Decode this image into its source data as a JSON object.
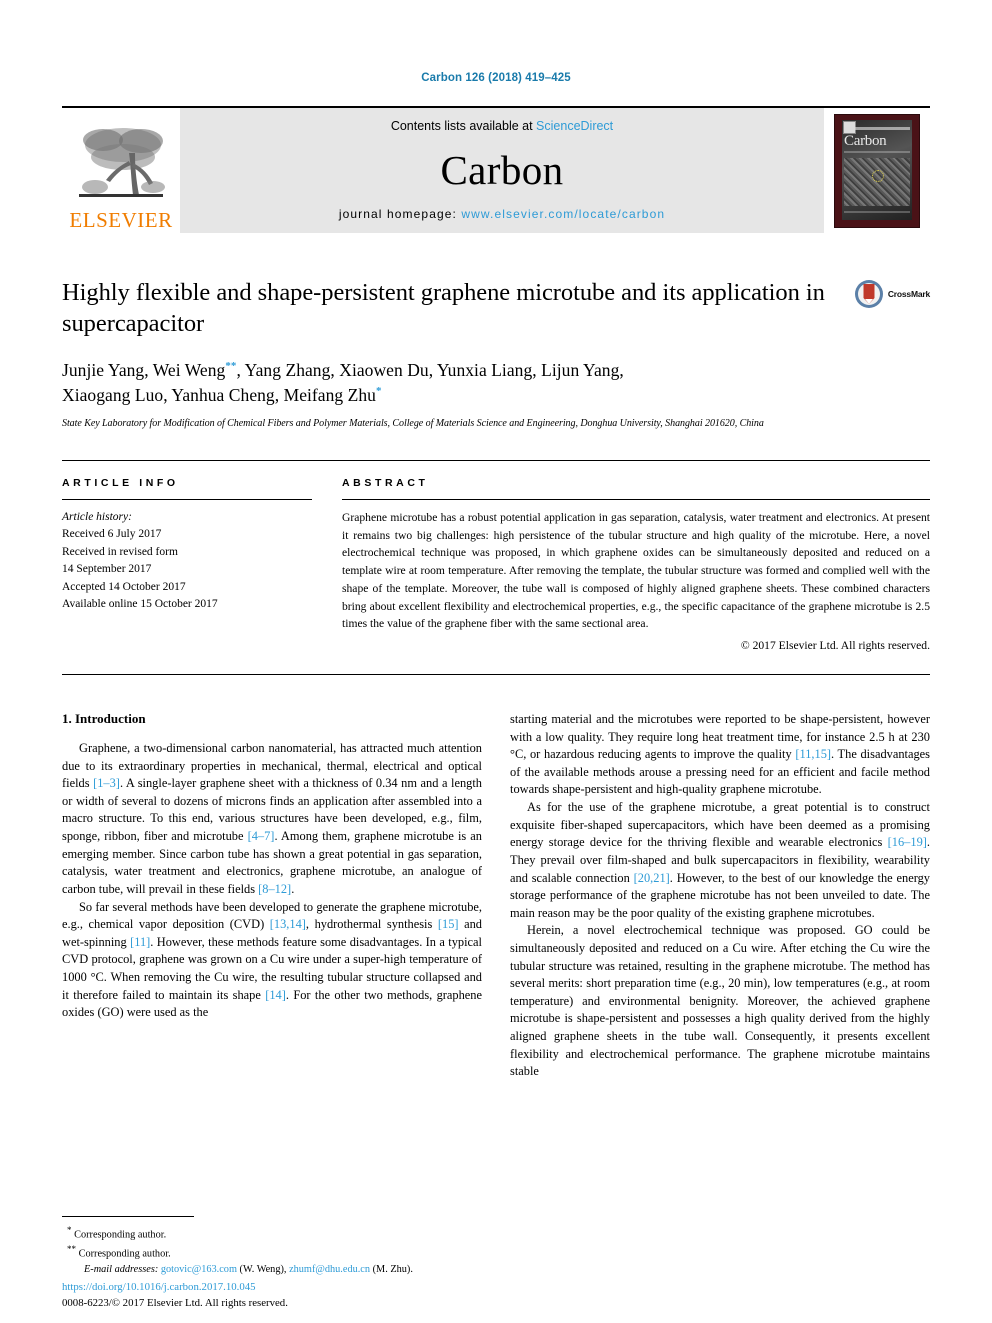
{
  "running_head": "Carbon 126 (2018) 419–425",
  "masthead": {
    "publisher_logo_text": "ELSEVIER",
    "contents_prefix": "Contents lists available at ",
    "contents_link": "ScienceDirect",
    "journal_name": "Carbon",
    "homepage_prefix": "journal homepage: ",
    "homepage_url": "www.elsevier.com/locate/carbon",
    "cover_title": "Carbon",
    "link_color": "#2e9bd6",
    "elsevier_orange": "#f07d00"
  },
  "article": {
    "title": "Highly flexible and shape-persistent graphene microtube and its application in supercapacitor",
    "crossmark_label": "CrossMark",
    "authors_line1_a": "Junjie Yang, Wei Weng",
    "authors_line1_sup": "**",
    "authors_line1_b": ", Yang Zhang, Xiaowen Du, Yunxia Liang, Lijun Yang,",
    "authors_line2_a": "Xiaogang Luo, Yanhua Cheng, Meifang Zhu",
    "authors_line2_sup": "*",
    "affiliation": "State Key Laboratory for Modification of Chemical Fibers and Polymer Materials, College of Materials Science and Engineering, Donghua University, Shanghai 201620, China"
  },
  "article_info": {
    "heading": "ARTICLE INFO",
    "history_label": "Article history:",
    "history": [
      "Received 6 July 2017",
      "Received in revised form",
      "14 September 2017",
      "Accepted 14 October 2017",
      "Available online 15 October 2017"
    ]
  },
  "abstract": {
    "heading": "ABSTRACT",
    "text": "Graphene microtube has a robust potential application in gas separation, catalysis, water treatment and electronics. At present it remains two big challenges: high persistence of the tubular structure and high quality of the microtube. Here, a novel electrochemical technique was proposed, in which graphene oxides can be simultaneously deposited and reduced on a template wire at room temperature. After removing the template, the tubular structure was formed and complied well with the shape of the template. Moreover, the tube wall is composed of highly aligned graphene sheets. These combined characters bring about excellent flexibility and electrochemical properties, e.g., the specific capacitance of the graphene microtube is 2.5 times the value of the graphene fiber with the same sectional area.",
    "copyright": "© 2017 Elsevier Ltd. All rights reserved."
  },
  "introduction": {
    "heading": "1. Introduction",
    "left_paragraphs": [
      {
        "segments": [
          {
            "t": "Graphene, a two-dimensional carbon nanomaterial, has attracted much attention due to its extraordinary properties in mechanical, thermal, electrical and optical fields ",
            "k": "text"
          },
          {
            "t": "[1–3]",
            "k": "ref"
          },
          {
            "t": ". A single-layer graphene sheet with a thickness of 0.34 nm and a length or width of several to dozens of microns finds an application after assembled into a macro structure. To this end, various structures have been developed, e.g., film, sponge, ribbon, fiber and microtube ",
            "k": "text"
          },
          {
            "t": "[4–7]",
            "k": "ref"
          },
          {
            "t": ". Among them, graphene microtube is an emerging member. Since carbon tube has shown a great potential in gas separation, catalysis, water treatment and electronics, graphene microtube, an analogue of carbon tube, will prevail in these fields ",
            "k": "text"
          },
          {
            "t": "[8–12]",
            "k": "ref"
          },
          {
            "t": ".",
            "k": "text"
          }
        ]
      },
      {
        "segments": [
          {
            "t": "So far several methods have been developed to generate the graphene microtube, e.g., chemical vapor deposition (CVD) ",
            "k": "text"
          },
          {
            "t": "[13,14]",
            "k": "ref"
          },
          {
            "t": ", hydrothermal synthesis ",
            "k": "text"
          },
          {
            "t": "[15]",
            "k": "ref"
          },
          {
            "t": " and wet-spinning ",
            "k": "text"
          },
          {
            "t": "[11]",
            "k": "ref"
          },
          {
            "t": ". However, these methods feature some disadvantages. In a typical CVD protocol, graphene was grown on a Cu wire under a super-high temperature of 1000 °C. When removing the Cu wire, the resulting tubular structure collapsed and it therefore failed to maintain its shape ",
            "k": "text"
          },
          {
            "t": "[14]",
            "k": "ref"
          },
          {
            "t": ". For the other two methods, graphene oxides (GO) were used as the",
            "k": "text"
          }
        ]
      }
    ],
    "right_paragraphs": [
      {
        "continued": true,
        "segments": [
          {
            "t": "starting material and the microtubes were reported to be shape-persistent, however with a low quality. They require long heat treatment time, for instance 2.5 h at 230 °C, or hazardous reducing agents to improve the quality ",
            "k": "text"
          },
          {
            "t": "[11,15]",
            "k": "ref"
          },
          {
            "t": ". The disadvantages of the available methods arouse a pressing need for an efficient and facile method towards shape-persistent and high-quality graphene microtube.",
            "k": "text"
          }
        ]
      },
      {
        "continued": false,
        "segments": [
          {
            "t": "As for the use of the graphene microtube, a great potential is to construct exquisite fiber-shaped supercapacitors, which have been deemed as a promising energy storage device for the thriving flexible and wearable electronics ",
            "k": "text"
          },
          {
            "t": "[16–19]",
            "k": "ref"
          },
          {
            "t": ". They prevail over film-shaped and bulk supercapacitors in flexibility, wearability and scalable connection ",
            "k": "text"
          },
          {
            "t": "[20,21]",
            "k": "ref"
          },
          {
            "t": ". However, to the best of our knowledge the energy storage performance of the graphene microtube has not been unveiled to date. The main reason may be the poor quality of the existing graphene microtubes.",
            "k": "text"
          }
        ]
      },
      {
        "continued": false,
        "segments": [
          {
            "t": "Herein, a novel electrochemical technique was proposed. GO could be simultaneously deposited and reduced on a Cu wire. After etching the Cu wire the tubular structure was retained, resulting in the graphene microtube. The method has several merits: short preparation time (e.g., 20 min), low temperatures (e.g., at room temperature) and environmental benignity. Moreover, the achieved graphene microtube is shape-persistent and possesses a high quality derived from the highly aligned graphene sheets in the tube wall. Consequently, it presents excellent flexibility and electrochemical performance. The graphene microtube maintains stable",
            "k": "text"
          }
        ]
      }
    ]
  },
  "footnotes": {
    "corresponding_1_sup": "*",
    "corresponding_1": "Corresponding author.",
    "corresponding_2_sup": "**",
    "corresponding_2": "Corresponding author.",
    "email_label": "E-mail addresses:",
    "email_1": "gotovic@163.com",
    "email_1_who": "(W. Weng),",
    "email_2": "zhumf@dhu.edu.cn",
    "email_2_who": "(M. Zhu).",
    "doi": "https://doi.org/10.1016/j.carbon.2017.10.045",
    "issn": "0008-6223/© 2017 Elsevier Ltd. All rights reserved."
  }
}
